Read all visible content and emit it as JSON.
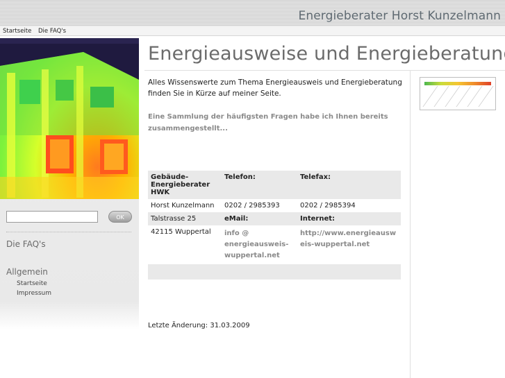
{
  "header": {
    "brand": "Energieberater Horst Kunzelmann"
  },
  "nav": {
    "items": [
      "Startseite",
      "Die FAQ's"
    ]
  },
  "sidebar": {
    "search": {
      "value": "",
      "placeholder": ""
    },
    "ok_label": "OK",
    "faq_label": "Die FAQ's",
    "section_title": "Allgemein",
    "links": [
      "Startseite",
      "Impressum"
    ]
  },
  "main": {
    "title": "Energieausweise und Energieberatung",
    "intro": "Alles Wissenswerte zum Thema Energieausweis und Energieberatung finden Sie in Kürze auf meiner Seite.",
    "collection": "Eine Sammlung der häufigsten Fragen habe ich Ihnen bereits zusammengestellt...",
    "contact": {
      "col1_header": "Gebäude-Energieberater HWK",
      "col2_header": "Telefon:",
      "col3_header": "Telefax:",
      "name": "Horst Kunzelmann",
      "phone": "0202 / 2985393",
      "fax": "0202 / 2985394",
      "street": "Talstrasse 25",
      "email_header": "eMail:",
      "internet_header": "Internet:",
      "city": "42115 Wuppertal",
      "email": "info @ energieausweis-wuppertal.net",
      "website": "http://www.energieausweis-wuppertal.net"
    },
    "last_change": "Letzte Änderung: 31.03.2009"
  },
  "colors": {
    "title_gray": "#6b6b6b",
    "link_gray": "#8a8a8a",
    "shade": "#e9e9e9"
  }
}
